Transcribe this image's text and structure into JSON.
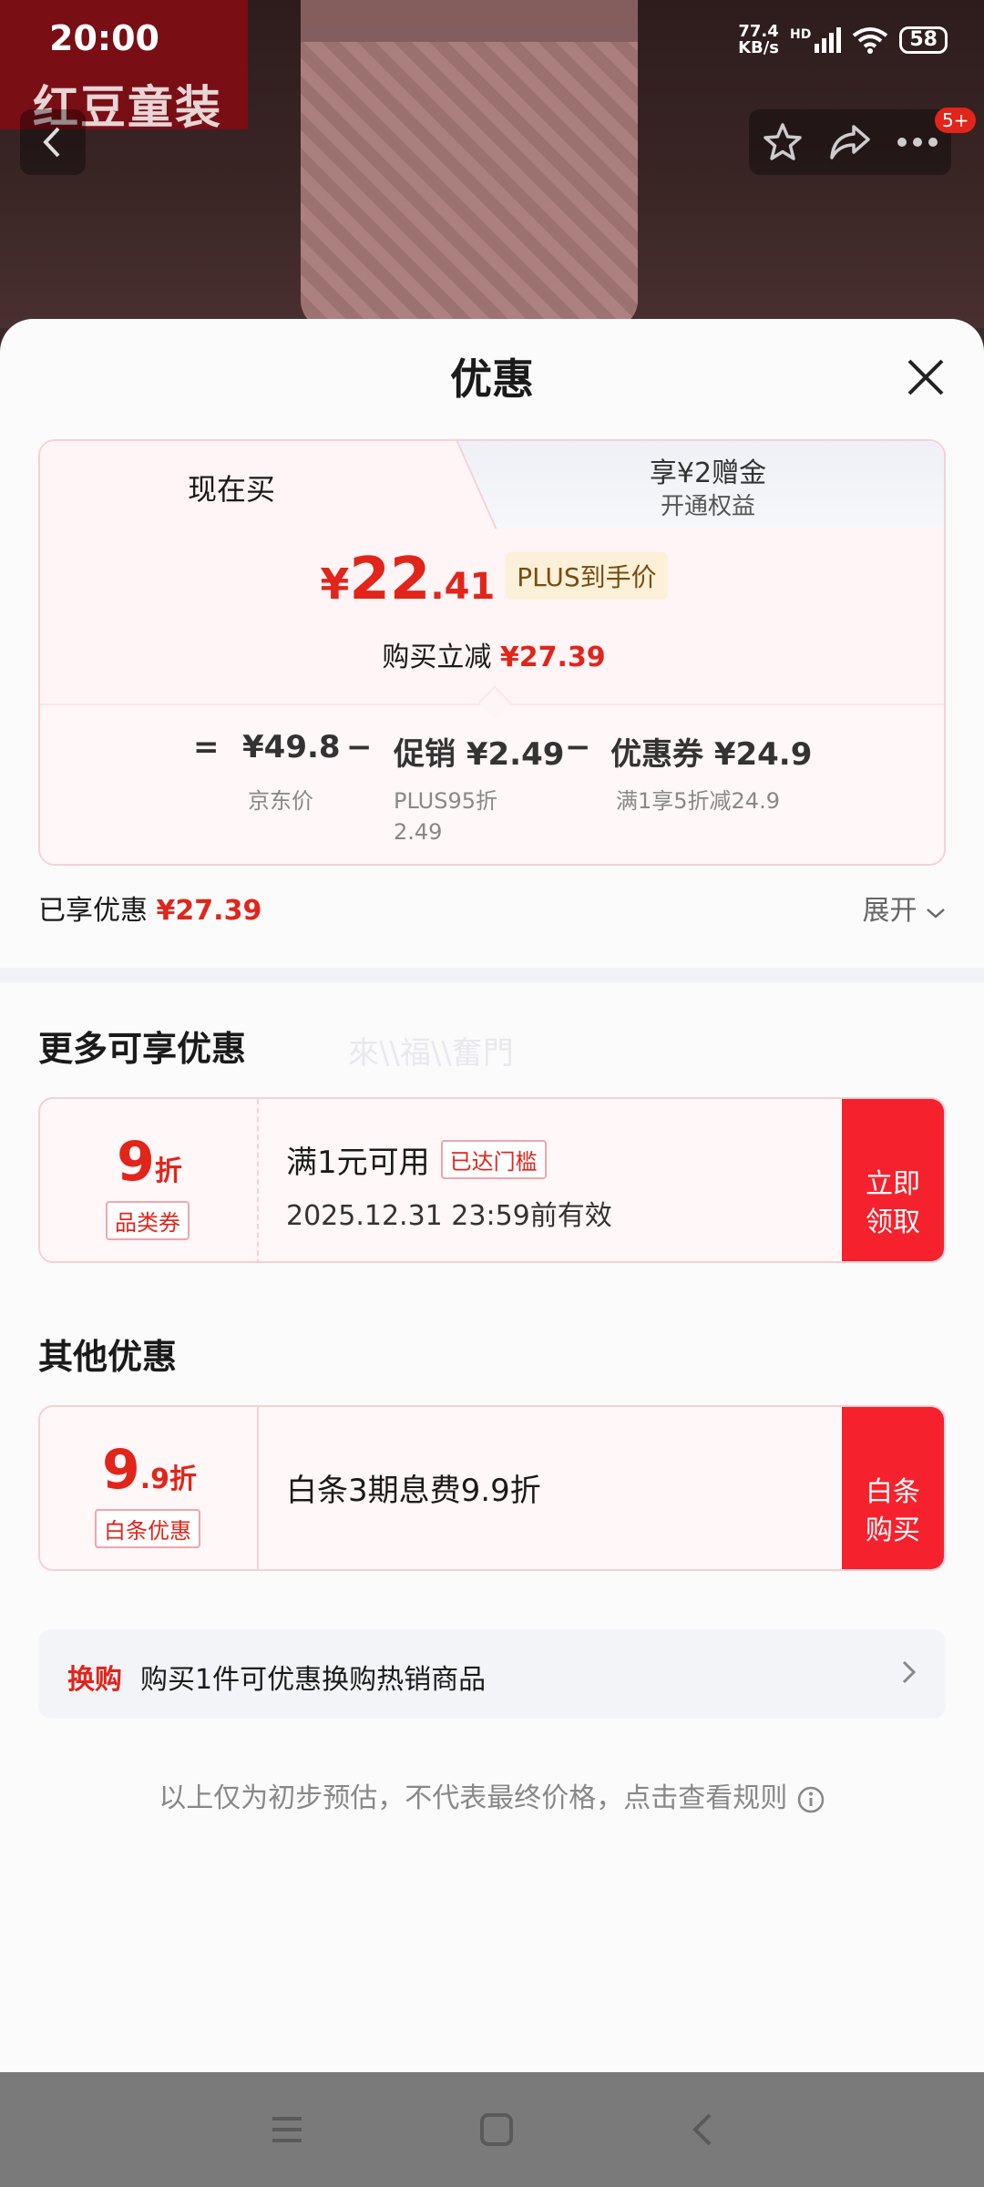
{
  "status": {
    "time": "20:00",
    "net_speed_value": "77.4",
    "net_speed_unit": "KB/s",
    "net_type": "HD",
    "battery": "58"
  },
  "product": {
    "brand": "红豆童装",
    "badge": "5+"
  },
  "sheet": {
    "title": "优惠",
    "tabs": {
      "now": "现在买",
      "bonus": "享¥2赠金",
      "bonus_sub": "开通权益"
    },
    "price": {
      "symbol": "¥",
      "int": "22",
      "dec": ".41",
      "tag": "PLUS到手价"
    },
    "reduce": {
      "label": "购买立减",
      "amount": "¥27.39"
    },
    "breakdown": {
      "equals": "=",
      "jd_price": "¥49.8",
      "jd_label": "京东价",
      "minus1": "−",
      "promo": "促销 ¥2.49",
      "promo_sub1": "PLUS95折",
      "promo_sub2": "2.49",
      "minus2": "−",
      "coupon": "优惠券 ¥24.9",
      "coupon_sub": "满1享5折减24.9"
    },
    "enjoyed": {
      "label": "已享优惠",
      "amount": "¥27.39"
    },
    "expand": "展开"
  },
  "more_offers": {
    "title": "更多可享优惠",
    "watermark": "來\\\\福\\\\奮門",
    "coupon": {
      "rate_big": "9",
      "rate_unit": "折",
      "tag": "品类券",
      "main": "满1元可用",
      "threshold": "已达门槛",
      "valid": "2025.12.31 23:59前有效",
      "button_line1": "立即",
      "button_line2": "领取"
    }
  },
  "other_offers": {
    "title": "其他优惠",
    "baitiao": {
      "rate_big": "9",
      "rate_small": ".9折",
      "tag": "白条优惠",
      "main": "白条3期息费9.9折",
      "button_line1": "白条",
      "button_line2": "购买"
    }
  },
  "exchange": {
    "tag": "换购",
    "text": "购买1件可优惠换购热销商品"
  },
  "disclaimer": "以上仅为初步预估，不代表最终价格，点击查看规则",
  "colors": {
    "accent": "#e1251b",
    "button": "#f5222d"
  }
}
